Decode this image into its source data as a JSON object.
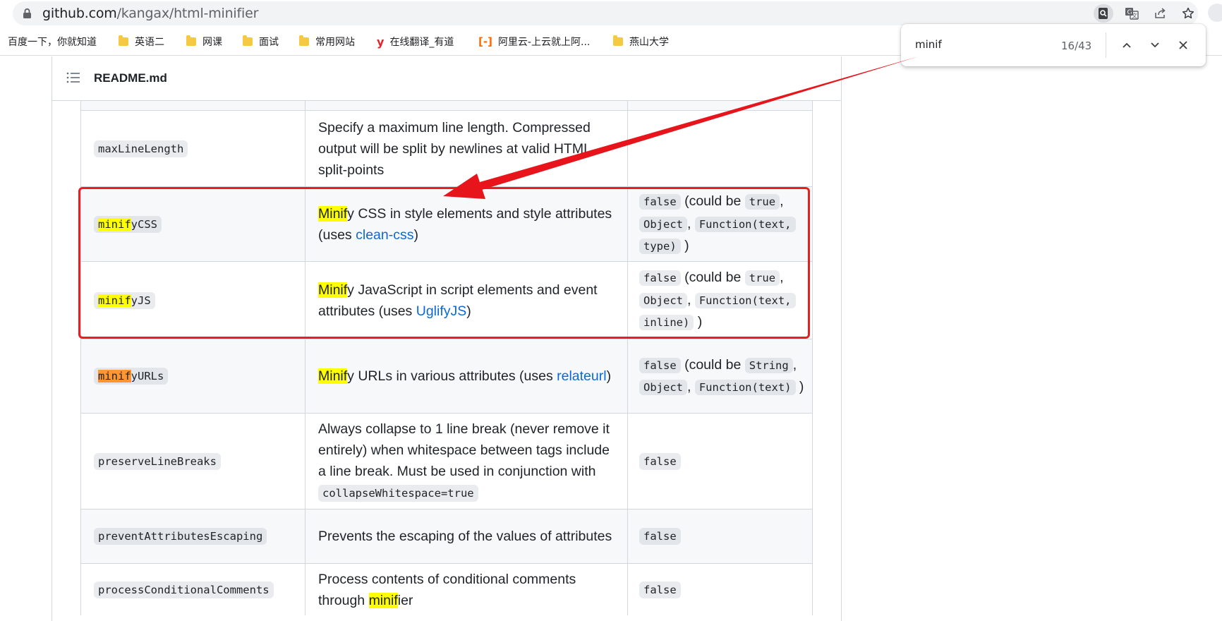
{
  "browser": {
    "url_host": "github.com",
    "url_path": "/kangax/html-minifier",
    "icons": [
      "lock-icon",
      "search-page-icon",
      "translate-icon",
      "share-icon",
      "star-icon"
    ]
  },
  "bookmarks": [
    {
      "label": "百度一下，你就知道",
      "icon": "none"
    },
    {
      "label": "英语二",
      "icon": "folder-icon"
    },
    {
      "label": "网课",
      "icon": "folder-icon"
    },
    {
      "label": "面试",
      "icon": "folder-icon"
    },
    {
      "label": "常用网站",
      "icon": "folder-icon"
    },
    {
      "label": "在线翻译_有道",
      "icon": "youdao-icon"
    },
    {
      "label": "阿里云-上云就上阿...",
      "icon": "aliyun-icon"
    },
    {
      "label": "燕山大学",
      "icon": "folder-icon"
    }
  ],
  "find_bar": {
    "query": "minif",
    "count": "16/43"
  },
  "readme": {
    "title": "README.md"
  },
  "rows": {
    "max_line_length": {
      "name": "maxLineLength",
      "desc": "Specify a maximum line length. Compressed output will be split by newlines at valid HTML split-points"
    },
    "minify_css": {
      "name_hl": "minif",
      "name_rest": "yCSS",
      "desc_hl": "Minif",
      "desc_rest": "y CSS in style elements and style attributes (uses ",
      "desc_link": "clean-css",
      "desc_end": ")",
      "def_false": "false",
      "def_could": " (could be ",
      "def_true": "true",
      "def_comma": ",",
      "def_object": "Object",
      "def_func": "Function(text,",
      "def_tail": "type)",
      "def_close": " )"
    },
    "minify_js": {
      "name_hl": "minif",
      "name_rest": "yJS",
      "desc_hl": "Minif",
      "desc_rest": "y JavaScript in script elements and event attributes (uses ",
      "desc_link": "UglifyJS",
      "desc_end": ")",
      "def_false": "false",
      "def_could": " (could be ",
      "def_true": "true",
      "def_comma": ",",
      "def_object": "Object",
      "def_func": "Function(text,",
      "def_tail": "inline)",
      "def_close": " )"
    },
    "minify_urls": {
      "name_hl": "minif",
      "name_rest": "yURLs",
      "desc_hl": "Minif",
      "desc_rest": "y URLs in various attributes (uses ",
      "desc_link": "relateurl",
      "desc_end": ")",
      "def_false": "false",
      "def_could": " (could be",
      "def_string": "String",
      "def_comma": ",",
      "def_object": "Object",
      "def_func": "Function(text)",
      "def_close": " )"
    },
    "preserve_line_breaks": {
      "name": "preserveLineBreaks",
      "desc": "Always collapse to 1 line break (never remove it entirely) when whitespace between tags include a line break. Must be used in conjunction with",
      "desc_code": "collapseWhitespace=true",
      "def": "false"
    },
    "prevent_attributes_escaping": {
      "name": "preventAttributesEscaping",
      "desc": "Prevents the escaping of the values of attributes",
      "def": "false"
    },
    "process_conditional_comments": {
      "name": "processConditionalComments",
      "desc_pre": "Process contents of conditional comments through ",
      "desc_hl": "minif",
      "desc_rest": "ier",
      "def": "false"
    }
  },
  "annotation": {
    "box_color": "#ee1c1c",
    "arrow_color": "#e8141b",
    "highlight_color": "#ffff00",
    "current_match_color": "#ff9632"
  }
}
